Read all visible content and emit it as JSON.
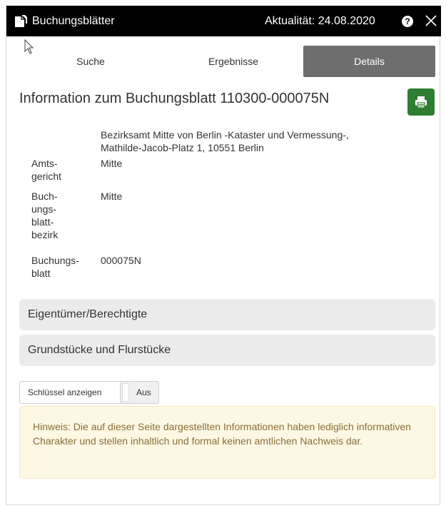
{
  "window": {
    "title": "Buchungsblätter",
    "updated": "Aktualität: 24.08.2020",
    "help_icon": "question-circle-icon",
    "close_icon": "close-icon",
    "app_icon": "document-icon"
  },
  "tabs": [
    {
      "label": "Suche",
      "active": false
    },
    {
      "label": "Ergebnisse",
      "active": false
    },
    {
      "label": "Details",
      "active": true
    }
  ],
  "details": {
    "heading": "Information zum Buchungsblatt 110300-000075N",
    "print_icon": "print-icon",
    "office_line1": "Bezirksamt Mitte von Berlin -Kataster und Vermessung-,",
    "office_line2": "Mathilde-Jacob-Platz 1, 10551 Berlin",
    "fields": [
      {
        "label_lines": [
          "Amts-",
          "gericht"
        ],
        "value": "Mitte"
      },
      {
        "label_lines": [
          "Buch-",
          "ungs-",
          "blatt-",
          "bezirk"
        ],
        "value": "Mitte"
      },
      {
        "label_lines": [
          "Buchungs-",
          "blatt"
        ],
        "value": "000075N"
      }
    ]
  },
  "sections": [
    {
      "label": "Eigentümer/Berechtigte"
    },
    {
      "label": "Grundstücke und Flurstücke"
    }
  ],
  "key_toggle": {
    "label": "Schlüssel anzeigen",
    "state": "Aus"
  },
  "notice": {
    "text": "Hinweis: Die auf dieser Seite dargestellten Informationen haben lediglich informativen Charakter und stellen inhaltlich und formal keinen amtlichen Nachweis dar."
  },
  "colors": {
    "titlebar": "#000000",
    "active_tab": "#6e6e6e",
    "print_button": "#2e7d32",
    "accordion": "#ebebeb",
    "notice_bg": "#fcf8e3",
    "notice_text": "#8a6d3b"
  }
}
